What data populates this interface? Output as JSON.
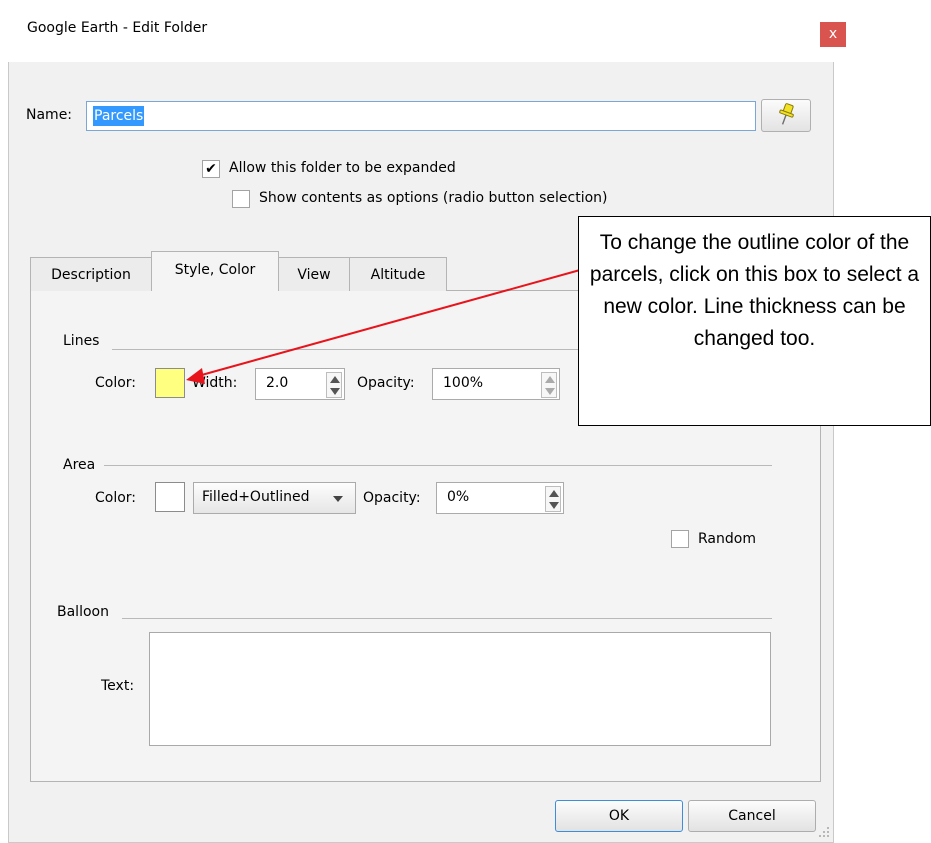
{
  "window": {
    "title": "Google Earth - Edit Folder",
    "close_label": "x"
  },
  "name_field": {
    "label": "Name:",
    "value": "Parcels"
  },
  "options": {
    "allow_expand": {
      "label": "Allow this folder to be expanded",
      "checked": true,
      "mark": "✔"
    },
    "show_contents": {
      "label": "Show contents as options (radio button selection)",
      "checked": false
    }
  },
  "tabs": [
    {
      "label": "Description"
    },
    {
      "label": "Style, Color",
      "active": true
    },
    {
      "label": "View"
    },
    {
      "label": "Altitude"
    }
  ],
  "lines": {
    "section_label": "Lines",
    "color_label": "Color:",
    "color": "#ffff80",
    "width_label": "Width:",
    "width_value": "2.0",
    "opacity_label": "Opacity:",
    "opacity_value": "100%"
  },
  "area": {
    "section_label": "Area",
    "color_label": "Color:",
    "color": "#ffffff",
    "fill_mode": "Filled+Outlined",
    "opacity_label": "Opacity:",
    "opacity_value": "0%",
    "random_label": "Random",
    "random_checked": false
  },
  "balloon": {
    "section_label": "Balloon",
    "text_label": "Text:",
    "text_value": ""
  },
  "buttons": {
    "ok": "OK",
    "cancel": "Cancel"
  },
  "annotation": {
    "text": "To change the outline color of the parcels, click on this box to select a new color. Line thickness can be changed too.",
    "arrow_color": "#e8141c"
  },
  "icons": {
    "pin": "pushpin-icon",
    "close": "close-icon"
  }
}
